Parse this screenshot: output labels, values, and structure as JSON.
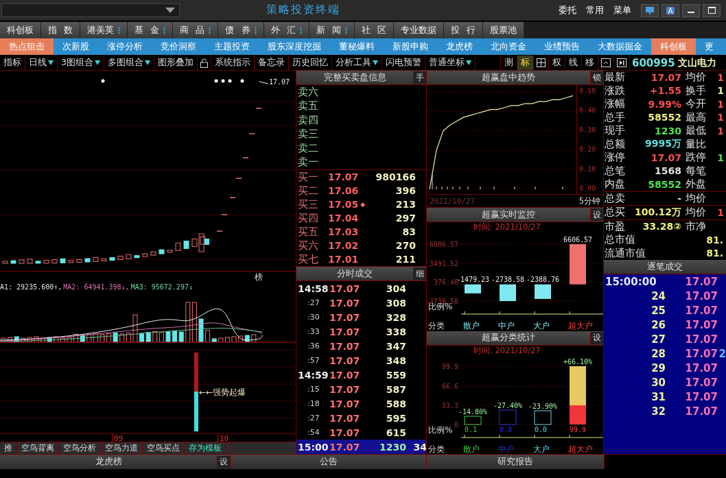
{
  "title_bar": {
    "title": "策略投资终端",
    "menu": [
      "委托",
      "常用",
      "菜单"
    ]
  },
  "market_tabs": [
    {
      "label": "科创板",
      "has_menu": false
    },
    {
      "label": "指 数",
      "has_menu": false
    },
    {
      "label": "港美英",
      "has_menu": true
    },
    {
      "label": "基 金",
      "has_menu": true
    },
    {
      "label": "商 品",
      "has_menu": true
    },
    {
      "label": "债 券",
      "has_menu": true
    },
    {
      "label": "外 汇",
      "has_menu": true
    },
    {
      "label": "新 闻",
      "has_menu": true
    },
    {
      "label": "社 区",
      "has_menu": false
    },
    {
      "label": "专业数据",
      "has_menu": false
    },
    {
      "label": "投 行",
      "has_menu": false
    },
    {
      "label": "股票池",
      "has_menu": false
    }
  ],
  "feature_tabs": [
    {
      "label": "热点狙击",
      "selected": true
    },
    {
      "label": "次新股",
      "selected": false
    },
    {
      "label": "涨停分析",
      "selected": false
    },
    {
      "label": "竞价洞察",
      "selected": false
    },
    {
      "label": "主题投资",
      "selected": false
    },
    {
      "label": "股东深度挖掘",
      "selected": false
    },
    {
      "label": "董秘爆料",
      "selected": false
    },
    {
      "label": "新股申购",
      "selected": false
    },
    {
      "label": "龙虎榜",
      "selected": false
    },
    {
      "label": "北向资金",
      "selected": false
    },
    {
      "label": "业绩预告",
      "selected": false
    },
    {
      "label": "大数据掘金",
      "selected": false
    },
    {
      "label": "科创板",
      "selected": true
    },
    {
      "label": "更",
      "selected": false
    }
  ],
  "toolbar": {
    "tools": [
      {
        "label": "指标",
        "dropdown": false
      },
      {
        "label": "日线",
        "dropdown": true
      },
      {
        "label": "3图组合",
        "dropdown": true
      },
      {
        "label": "多图组合",
        "dropdown": true
      },
      {
        "label": "图形叠加",
        "dropdown": false
      },
      {
        "label": "系统指示",
        "dropdown": false
      },
      {
        "label": "备忘录",
        "dropdown": false
      },
      {
        "label": "历史回忆",
        "dropdown": false
      },
      {
        "label": "分析工具",
        "dropdown": true
      },
      {
        "label": "闪电预警",
        "dropdown": false
      },
      {
        "label": "普通坐标",
        "dropdown": true
      }
    ],
    "chart_tools": [
      {
        "label": "测",
        "selected": false
      },
      {
        "label": "标",
        "selected": true
      },
      {
        "label": "权",
        "selected": false
      },
      {
        "label": "线",
        "selected": false
      },
      {
        "label": "移",
        "selected": false
      }
    ],
    "stock": {
      "code": "600995",
      "name": "文山电力"
    }
  },
  "kline": {
    "high_label": "17.07",
    "badge": "榜",
    "ma_legend": [
      {
        "text": "A1: 29235.600↑,",
        "color": "#e8e8e8"
      },
      {
        "text": "MA2: 64941.398↓,",
        "color": "#e070b0"
      },
      {
        "text": "MA3: 95672.297↓",
        "color": "#70d8a0"
      }
    ],
    "signal_label": "←←强势起爆",
    "axis_labels": [
      "09",
      "10"
    ],
    "bottom_tabs": [
      {
        "label": "推",
        "kind": "tab"
      },
      {
        "label": "空鸟背离",
        "kind": "tab"
      },
      {
        "label": "空鸟分析",
        "kind": "tab"
      },
      {
        "label": "空鸟力道",
        "kind": "tab"
      },
      {
        "label": "空鸟买点",
        "kind": "tab"
      },
      {
        "label": "存为模板",
        "kind": "action"
      }
    ]
  },
  "order_book": {
    "title": "完整买卖盘信息",
    "button": "手",
    "sell": [
      {
        "label": "卖六"
      },
      {
        "label": "卖五"
      },
      {
        "label": "卖四"
      },
      {
        "label": "卖三"
      },
      {
        "label": "卖二"
      },
      {
        "label": "卖一"
      }
    ],
    "buy": [
      {
        "label": "买一",
        "price": "17.07",
        "volume": "980166"
      },
      {
        "label": "买二",
        "price": "17.06",
        "volume": "396"
      },
      {
        "label": "买三",
        "price": "17.05",
        "volume": "213",
        "marker": "◆"
      },
      {
        "label": "买四",
        "price": "17.04",
        "volume": "297"
      },
      {
        "label": "买五",
        "price": "17.03",
        "volume": "83"
      },
      {
        "label": "买六",
        "price": "17.02",
        "volume": "270"
      },
      {
        "label": "买七",
        "price": "17.01",
        "volume": "211"
      }
    ]
  },
  "ticks": {
    "title": "分时成交",
    "button": "细",
    "rows": [
      {
        "time": "14:58",
        "kind": "minute",
        "price": "17.07",
        "volume": "304",
        "selected": false
      },
      {
        "time": ":27",
        "kind": "second",
        "price": "17.07",
        "volume": "308",
        "selected": false
      },
      {
        "time": ":30",
        "kind": "second",
        "price": "17.07",
        "volume": "328",
        "selected": false
      },
      {
        "time": ":33",
        "kind": "second",
        "price": "17.07",
        "volume": "338",
        "selected": false
      },
      {
        "time": ":36",
        "kind": "second",
        "price": "17.07",
        "volume": "347",
        "selected": false
      },
      {
        "time": ":57",
        "kind": "second",
        "price": "17.07",
        "volume": "348",
        "selected": false
      },
      {
        "time": "14:59",
        "kind": "minute",
        "price": "17.07",
        "volume": "559",
        "selected": false
      },
      {
        "time": ":15",
        "kind": "second",
        "price": "17.07",
        "volume": "587",
        "selected": false
      },
      {
        "time": ":18",
        "kind": "second",
        "price": "17.07",
        "volume": "588",
        "selected": false
      },
      {
        "time": ":27",
        "kind": "second",
        "price": "17.07",
        "volume": "595",
        "selected": false
      },
      {
        "time": ":54",
        "kind": "second",
        "price": "17.07",
        "volume": "615",
        "selected": false
      },
      {
        "time": "15:00",
        "kind": "minute",
        "price": "17.07",
        "volume": "1230",
        "count": "34",
        "selected": true
      }
    ]
  },
  "trend": {
    "title": "超赢盘中趋势",
    "button": "锁",
    "period": "5分钟",
    "chart_data": {
      "type": "line",
      "xlabel": "2021/10/27",
      "ylim": [
        0,
        0.5
      ],
      "grid": true,
      "yticks": [
        {
          "value": 0.5,
          "label": "0.50"
        },
        {
          "value": 0.4,
          "label": "0.40"
        },
        {
          "value": 0.3,
          "label": "0.30"
        },
        {
          "value": 0.2,
          "label": "0.20"
        },
        {
          "value": 0.1,
          "label": "0.10"
        },
        {
          "value": 0,
          "label": "0.00"
        }
      ],
      "values": [
        0,
        0.2,
        0.3,
        0.33,
        0.35,
        0.37,
        0.38,
        0.39,
        0.4,
        0.41,
        0.41,
        0.42,
        0.43,
        0.43,
        0.44,
        0.44,
        0.45,
        0.45,
        0.46,
        0.46,
        0.47,
        0.48
      ]
    }
  },
  "monitor": {
    "title": "超赢实时监控",
    "button": "设",
    "time": "时间: 2021/10/27",
    "ratio_label": "比例%",
    "category_label": "分类",
    "chart_data": {
      "type": "bar",
      "categories": [
        "散户",
        "中户",
        "大户",
        "超大户"
      ],
      "values": [
        -1479.23,
        -2738.58,
        -2388.76,
        6606.57
      ],
      "ylim": [
        -2738.58,
        6606.57
      ],
      "yticks": [
        {
          "value": 6606.57,
          "label": "6606.57"
        },
        {
          "value": 3491.52,
          "label": "3491.52"
        },
        {
          "value": 376.46,
          "label": "376.46"
        },
        {
          "value": -2738.58,
          "label": "-2738.58"
        }
      ],
      "value_labels": [
        "-1479.23",
        "-2738.58",
        "-2388.76",
        "6606.57"
      ]
    }
  },
  "stats": {
    "title": "超赢分类统计",
    "button": "设",
    "time": "时间: 2021/10/27",
    "ratio_label": "比例%",
    "category_label": "分类",
    "ratios": [
      "0.1",
      "0.0",
      "0.0",
      "99.9"
    ],
    "axis_ticks": [
      "99.9",
      "66.6",
      "33.3",
      "0"
    ],
    "categories": [
      "散户",
      "中户",
      "大户",
      "超大户"
    ],
    "percent_labels": [
      "-14.80%",
      "-27.40%",
      "-23.90%",
      "+66.10%"
    ]
  },
  "quote": {
    "rows": [
      {
        "kind": "pair",
        "cells": [
          {
            "label": "最新",
            "value": "17.07",
            "color": "#ff5050"
          },
          {
            "label": "均价",
            "value": "1",
            "color": "#ff5050"
          }
        ]
      },
      {
        "kind": "pair",
        "cells": [
          {
            "label": "涨跌",
            "value": "+1.55",
            "color": "#ff5050"
          },
          {
            "label": "换手",
            "value": "1",
            "color": "#f0f0a0"
          }
        ]
      },
      {
        "kind": "pair",
        "cells": [
          {
            "label": "涨幅",
            "value": "9.99%",
            "color": "#ff5050"
          },
          {
            "label": "今开",
            "value": "1",
            "color": "#ff5050"
          }
        ]
      },
      {
        "kind": "pair",
        "cells": [
          {
            "label": "总手",
            "value": "58552",
            "color": "#f0f080"
          },
          {
            "label": "最高",
            "value": "1",
            "color": "#ff5050"
          }
        ]
      },
      {
        "kind": "pair",
        "cells": [
          {
            "label": "现手",
            "value": "1230",
            "color": "#50e050"
          },
          {
            "label": "最低",
            "value": "1",
            "color": "#ff5050"
          }
        ]
      },
      {
        "kind": "pair",
        "cells": [
          {
            "label": "总额",
            "value": "9995万",
            "color": "#60e0e0"
          },
          {
            "label": "量比"
          }
        ]
      },
      {
        "kind": "pair",
        "cells": [
          {
            "label": "涨停",
            "value": "17.07",
            "color": "#ff5050"
          },
          {
            "label": "跌停",
            "value": "1",
            "color": "#50e050"
          }
        ]
      },
      {
        "kind": "pair",
        "cells": [
          {
            "label": "总笔",
            "value": "1568"
          },
          {
            "label": "每笔"
          }
        ]
      },
      {
        "kind": "pair",
        "cells": [
          {
            "label": "内盘",
            "value": "58552",
            "color": "#50e050"
          },
          {
            "label": "外盘"
          }
        ]
      },
      {
        "kind": "pair",
        "cells": [
          {
            "label": "总卖",
            "value": "-"
          },
          {
            "label": "均价"
          }
        ]
      },
      {
        "kind": "pair",
        "cells": [
          {
            "label": "总买",
            "value": "100.12万",
            "color": "#f0f080"
          },
          {
            "label": "均价",
            "value": "1",
            "color": "#ff5050"
          }
        ]
      },
      {
        "kind": "pair",
        "cells": [
          {
            "label": "市盈",
            "value": "33.28②",
            "color": "#f0f080"
          },
          {
            "label": "市净"
          }
        ]
      },
      {
        "kind": "single",
        "cells": [
          {
            "label": "总市值",
            "value": "81.",
            "color": "#f0f080"
          }
        ]
      },
      {
        "kind": "single",
        "cells": [
          {
            "label": "流通市值",
            "value": "81.",
            "color": "#f0f080"
          }
        ]
      }
    ]
  },
  "trades": {
    "title": "逐笔成交",
    "rows": [
      {
        "time": "15:00:00",
        "kind": "full",
        "price": "17.07"
      },
      {
        "time": "24",
        "kind": "short",
        "price": "17.07"
      },
      {
        "time": "25",
        "kind": "short",
        "price": "17.07"
      },
      {
        "time": "26",
        "kind": "short",
        "price": "17.07"
      },
      {
        "time": "27",
        "kind": "short",
        "price": "17.07"
      },
      {
        "time": "28",
        "kind": "short",
        "price": "17.07",
        "column_3": "2"
      },
      {
        "time": "29",
        "kind": "short",
        "price": "17.07"
      },
      {
        "time": "30",
        "kind": "short",
        "price": "17.07"
      },
      {
        "time": "31",
        "kind": "short",
        "price": "17.07"
      },
      {
        "time": "32",
        "kind": "short",
        "price": "17.07"
      }
    ]
  },
  "bottom_panels": [
    {
      "title": "龙虎榜",
      "button": "设"
    },
    {
      "title": "公告"
    },
    {
      "title": "研究报告"
    }
  ]
}
